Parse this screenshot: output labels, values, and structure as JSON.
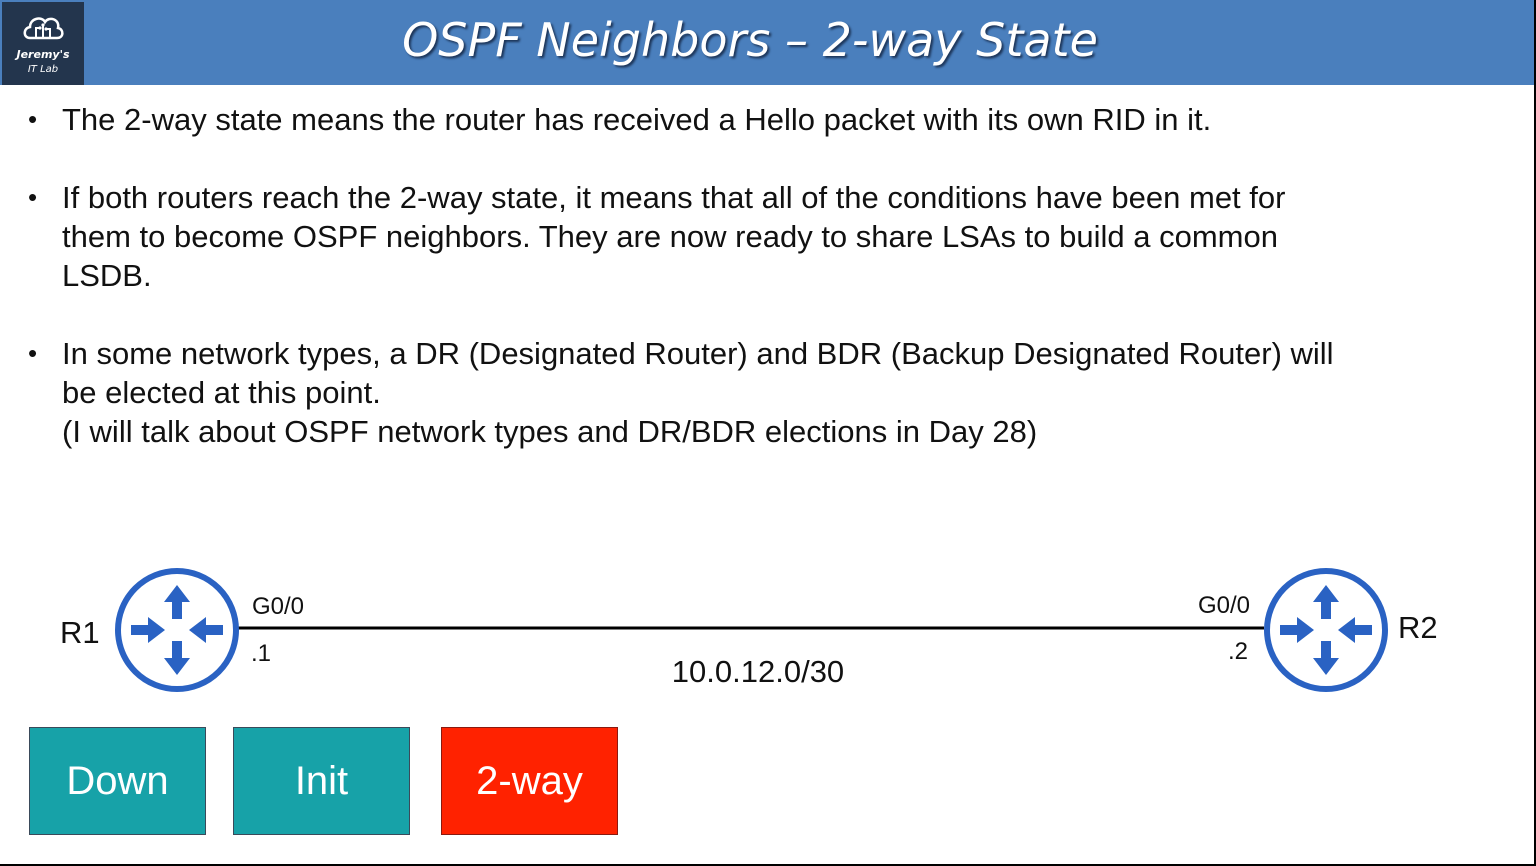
{
  "logo": {
    "line1": "Jeremy's",
    "line2": "IT Lab",
    "icon": "cloud-circuit-icon"
  },
  "title": "OSPF Neighbors – 2-way State",
  "bullets": [
    {
      "lines": [
        "The 2-way state means the router has received a Hello packet with its own RID in it."
      ]
    },
    {
      "lines": [
        "If both routers reach the 2-way state, it means that all of the conditions have been met for",
        "them to become OSPF neighbors.  They are now ready to share LSAs to build a common",
        "LSDB."
      ]
    },
    {
      "lines": [
        "In some network types, a DR (Designated Router) and BDR (Backup Designated Router) will",
        "be elected at this point.",
        "(I will talk about OSPF network types and DR/BDR elections in Day 28)"
      ]
    }
  ],
  "diagram": {
    "r1": {
      "name": "R1",
      "interface": "G0/0",
      "host": ".1",
      "icon": "router-icon"
    },
    "r2": {
      "name": "R2",
      "interface": "G0/0",
      "host": ".2",
      "icon": "router-icon"
    },
    "subnet": "10.0.12.0/30"
  },
  "states": [
    {
      "label": "Down",
      "color": "#17a2a8"
    },
    {
      "label": "Init",
      "color": "#17a2a8"
    },
    {
      "label": "2-way",
      "color": "#ff2200"
    }
  ],
  "colors": {
    "header": "#4a7fbd",
    "logo_bg": "#23354d",
    "router": "#2a62c3"
  }
}
